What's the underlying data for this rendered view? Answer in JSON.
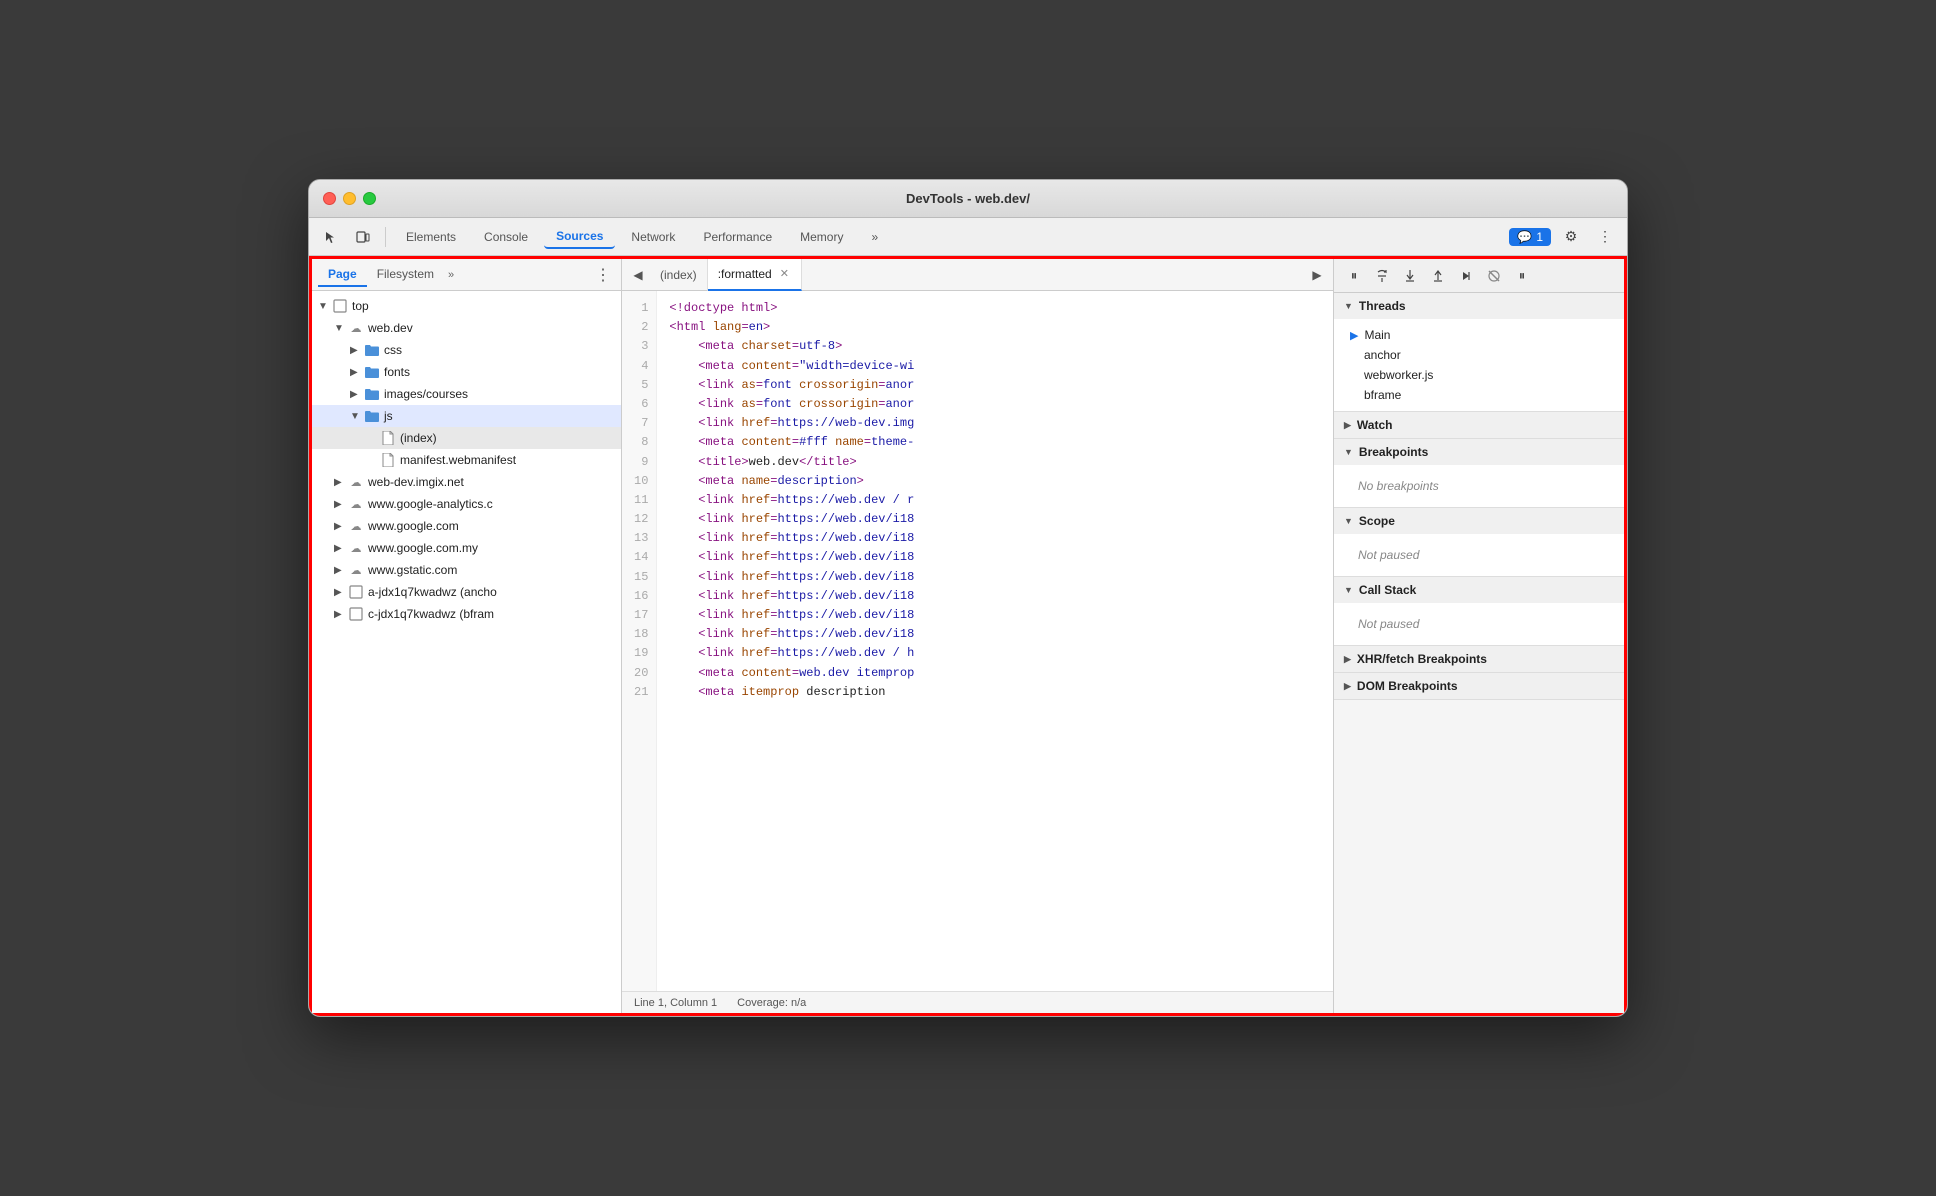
{
  "window": {
    "title": "DevTools - web.dev/"
  },
  "toolbar": {
    "tabs": [
      {
        "label": "Elements",
        "active": false
      },
      {
        "label": "Console",
        "active": false
      },
      {
        "label": "Sources",
        "active": true
      },
      {
        "label": "Network",
        "active": false
      },
      {
        "label": "Performance",
        "active": false
      },
      {
        "label": "Memory",
        "active": false
      }
    ],
    "more_label": "»",
    "badge_count": "1",
    "settings_icon": "⚙",
    "more_icon": "⋮"
  },
  "left_panel": {
    "tabs": [
      {
        "label": "Page",
        "active": true
      },
      {
        "label": "Filesystem",
        "active": false
      }
    ],
    "more": "»",
    "tree": [
      {
        "level": 1,
        "type": "folder-open",
        "label": "top",
        "indent": 1
      },
      {
        "level": 2,
        "type": "cloud-open",
        "label": "web.dev",
        "indent": 2
      },
      {
        "level": 3,
        "type": "folder",
        "label": "css",
        "indent": 3
      },
      {
        "level": 3,
        "type": "folder",
        "label": "fonts",
        "indent": 3
      },
      {
        "level": 3,
        "type": "folder",
        "label": "images/courses",
        "indent": 3
      },
      {
        "level": 3,
        "type": "folder-open",
        "label": "js",
        "indent": 3,
        "selected": true
      },
      {
        "level": 4,
        "type": "file",
        "label": "(index)",
        "indent": 4,
        "selected": true
      },
      {
        "level": 4,
        "type": "file",
        "label": "manifest.webmanifest",
        "indent": 4
      },
      {
        "level": 2,
        "type": "cloud",
        "label": "web-dev.imgix.net",
        "indent": 2
      },
      {
        "level": 2,
        "type": "cloud",
        "label": "www.google-analytics.c",
        "indent": 2
      },
      {
        "level": 2,
        "type": "cloud",
        "label": "www.google.com",
        "indent": 2
      },
      {
        "level": 2,
        "type": "cloud",
        "label": "www.google.com.my",
        "indent": 2
      },
      {
        "level": 2,
        "type": "cloud",
        "label": "www.gstatic.com",
        "indent": 2
      },
      {
        "level": 2,
        "type": "frame",
        "label": "a-jdx1q7kwadwz (ancho",
        "indent": 2
      },
      {
        "level": 2,
        "type": "frame",
        "label": "c-jdx1q7kwadwz (bfram",
        "indent": 2
      }
    ]
  },
  "editor": {
    "tabs": [
      {
        "label": "(index)",
        "active": false
      },
      {
        "label": ":formatted",
        "active": true,
        "closable": true
      }
    ],
    "lines": [
      {
        "num": 1,
        "content": "<!doctype html>",
        "type": "text"
      },
      {
        "num": 2,
        "content": "<html lang=en>",
        "type": "html"
      },
      {
        "num": 3,
        "content": "    <meta charset=utf-8>",
        "type": "html"
      },
      {
        "num": 4,
        "content": "    <meta content=\"width=device-wi",
        "type": "html"
      },
      {
        "num": 5,
        "content": "    <link as=font crossorigin=anor",
        "type": "html"
      },
      {
        "num": 6,
        "content": "    <link as=font crossorigin=anor",
        "type": "html"
      },
      {
        "num": 7,
        "content": "    <link href=https://web-dev.img",
        "type": "html"
      },
      {
        "num": 8,
        "content": "    <meta content=#fff name=theme-",
        "type": "html"
      },
      {
        "num": 9,
        "content": "    <title>web.dev</title>",
        "type": "html"
      },
      {
        "num": 10,
        "content": "    <meta name=description>",
        "type": "html"
      },
      {
        "num": 11,
        "content": "    <link href=https://web.dev / r",
        "type": "html"
      },
      {
        "num": 12,
        "content": "    <link href=https://web.dev/i18",
        "type": "html"
      },
      {
        "num": 13,
        "content": "    <link href=https://web.dev/i18",
        "type": "html"
      },
      {
        "num": 14,
        "content": "    <link href=https://web.dev/i18",
        "type": "html"
      },
      {
        "num": 15,
        "content": "    <link href=https://web.dev/i18",
        "type": "html"
      },
      {
        "num": 16,
        "content": "    <link href=https://web.dev/i18",
        "type": "html"
      },
      {
        "num": 17,
        "content": "    <link href=https://web.dev/i18",
        "type": "html"
      },
      {
        "num": 18,
        "content": "    <link href=https://web.dev/i18",
        "type": "html"
      },
      {
        "num": 19,
        "content": "    <link href=https://web.dev / h",
        "type": "html"
      },
      {
        "num": 20,
        "content": "    <meta content=web.dev itemprop",
        "type": "html"
      },
      {
        "num": 21,
        "content": "    <meta itemprop description",
        "type": "html"
      }
    ],
    "statusbar": {
      "position": "Line 1, Column 1",
      "coverage": "Coverage: n/a"
    }
  },
  "right_panel": {
    "sections": [
      {
        "id": "threads",
        "label": "Threads",
        "expanded": true,
        "items": [
          {
            "label": "Main",
            "active": true
          },
          {
            "label": "anchor"
          },
          {
            "label": "webworker.js"
          },
          {
            "label": "bframe"
          }
        ]
      },
      {
        "id": "watch",
        "label": "Watch",
        "expanded": false
      },
      {
        "id": "breakpoints",
        "label": "Breakpoints",
        "expanded": true,
        "empty_label": "No breakpoints"
      },
      {
        "id": "scope",
        "label": "Scope",
        "expanded": true,
        "empty_label": "Not paused"
      },
      {
        "id": "call-stack",
        "label": "Call Stack",
        "expanded": true,
        "empty_label": "Not paused"
      },
      {
        "id": "xhr-breakpoints",
        "label": "XHR/fetch Breakpoints",
        "expanded": false
      },
      {
        "id": "dom-breakpoints",
        "label": "DOM Breakpoints",
        "expanded": false
      }
    ]
  }
}
